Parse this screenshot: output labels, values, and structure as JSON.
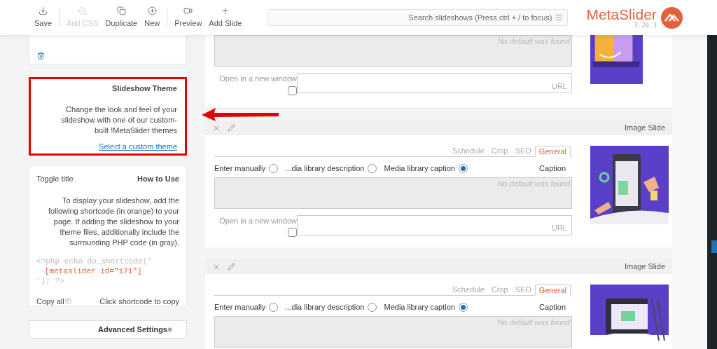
{
  "toolbar": {
    "buttons": [
      {
        "kind": "save",
        "label": "Save",
        "disabled": false
      },
      {
        "kind": "css",
        "label": "Add CSS",
        "disabled": true
      },
      {
        "kind": "duplicate",
        "label": "Duplicate",
        "disabled": false
      },
      {
        "kind": "new",
        "label": "New",
        "disabled": false
      },
      {
        "kind": "preview",
        "label": "Preview",
        "disabled": false
      },
      {
        "kind": "add",
        "label": "Add Slide",
        "disabled": false
      }
    ],
    "search": {
      "placeholder": "Search slideshows (Press ctrl + / to focus)"
    },
    "logo": {
      "name": "MetaSlider",
      "version": "3.20.3"
    }
  },
  "sidebar": {
    "theme_card": {
      "title": "Slideshow Theme",
      "description": "Change the look and feel of your slideshow with one of our custom-built !MetaSlider themes",
      "link": "Select a custom theme",
      "highlighted": true
    },
    "how_to": {
      "toggle": "Toggle title",
      "title": "How to Use",
      "description": "To display your slideshow, add the following shortcode (in orange) to your page. If adding the slideshow to your theme files, additionally include the surrounding PHP code (in gray).",
      "code": [
        {
          "kind": "php",
          "text": "<?php echo do_shortcode('"
        },
        {
          "kind": "shortcode",
          "text": "[metaslider id=\"171\"]"
        },
        {
          "kind": "php",
          "text": "'); ?>"
        }
      ],
      "copy_all": "Copy all",
      "hint": "Click shortcode to copy"
    },
    "advanced": "Advanced Settings"
  },
  "slides": [
    {
      "caption_placeholder": "No default was found",
      "link": {
        "label": "Open in a new window",
        "placeholder": "URL",
        "checked": false
      }
    },
    {
      "type": "Image Slide",
      "tabs": [
        {
          "label": "Schedule",
          "selected": false
        },
        {
          "label": "Crop",
          "selected": false
        },
        {
          "label": "SEO",
          "selected": false
        },
        {
          "label": "General",
          "selected": true
        }
      ],
      "sources": [
        {
          "label": "Enter manually",
          "selected": false
        },
        {
          "label": "...dia library description",
          "selected": false
        },
        {
          "label": "Media library caption",
          "selected": true
        }
      ],
      "caption_label": "Caption",
      "caption_placeholder": "No default was found",
      "link": {
        "label": "Open in a new window",
        "placeholder": "URL",
        "checked": false
      }
    },
    {
      "type": "Image Slide",
      "tabs": [
        {
          "label": "Schedule",
          "selected": false
        },
        {
          "label": "Crop",
          "selected": false
        },
        {
          "label": "SEO",
          "selected": false
        },
        {
          "label": "General",
          "selected": true
        }
      ],
      "sources": [
        {
          "label": "Enter manually",
          "selected": false
        },
        {
          "label": "...dia library description",
          "selected": false
        },
        {
          "label": "Media library caption",
          "selected": true
        }
      ],
      "caption_label": "Caption",
      "caption_placeholder": "No default was found"
    }
  ]
}
